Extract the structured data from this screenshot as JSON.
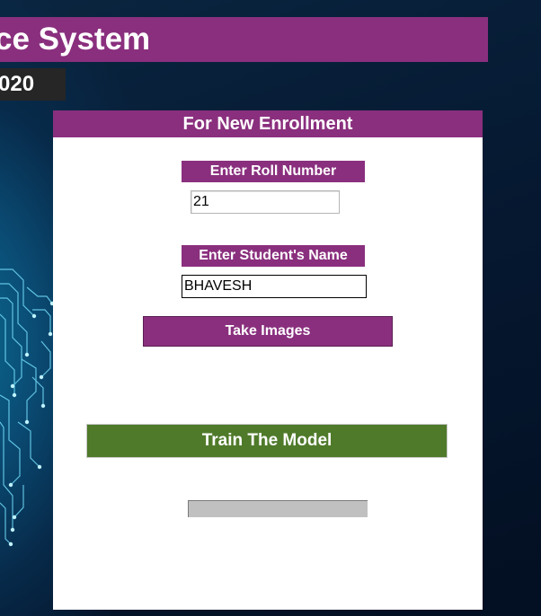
{
  "header": {
    "title": "ce System",
    "date": "020"
  },
  "enrollment": {
    "heading": "For New Enrollment",
    "roll_label": "Enter Roll Number",
    "roll_value": "21",
    "name_label": "Enter Student's Name",
    "name_value": "BHAVESH",
    "take_images_label": "Take Images",
    "train_label": "Train The Model",
    "progress_fraction": 0
  },
  "colors": {
    "accent_purple": "#8a2f7e",
    "train_green": "#4f7a2a",
    "progress_track": "#c0c0c0"
  }
}
